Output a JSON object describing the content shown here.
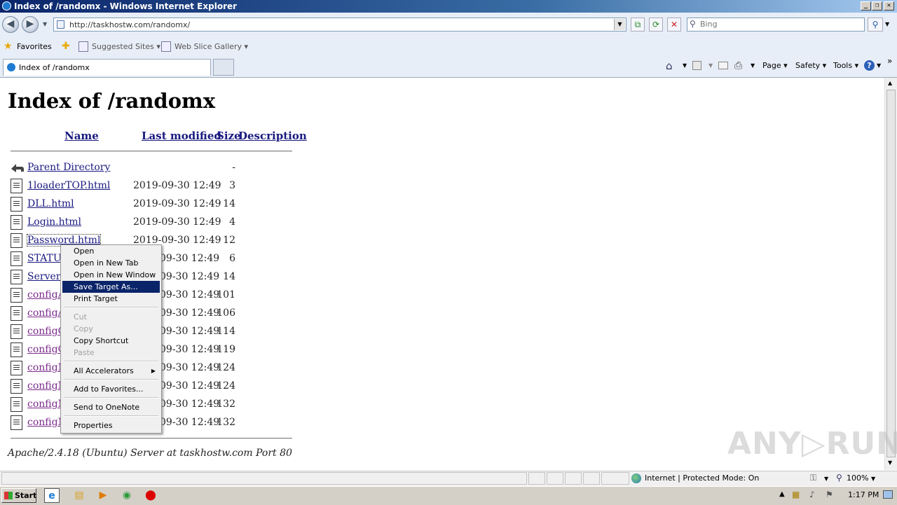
{
  "window": {
    "title": "Index of /randomx - Windows Internet Explorer",
    "minimize": "_",
    "restore": "❐",
    "close": "✕"
  },
  "address": {
    "url": "http://taskhostw.com/randomx/",
    "search_placeholder": "Bing"
  },
  "favorites": {
    "label": "Favorites",
    "suggested": "Suggested Sites ▾",
    "webslice": "Web Slice Gallery ▾"
  },
  "tab": {
    "label": "Index of /randomx"
  },
  "commandbar": {
    "page": "Page ▾",
    "safety": "Safety ▾",
    "tools": "Tools ▾",
    "more": "»"
  },
  "page": {
    "heading": "Index of /randomx",
    "columns": {
      "name": "Name",
      "modified": "Last modified",
      "size": "Size",
      "description": "Description"
    },
    "parent": {
      "name": "Parent Directory",
      "size": "-"
    },
    "rows": [
      {
        "name": "1loaderTOP.html",
        "modified": "2019-09-30 12:49",
        "size": "3"
      },
      {
        "name": "DLL.html",
        "modified": "2019-09-30 12:49",
        "size": "14"
      },
      {
        "name": "Login.html",
        "modified": "2019-09-30 12:49",
        "size": "4"
      },
      {
        "name": "Password.html",
        "modified": "2019-09-30 12:49",
        "size": "12"
      },
      {
        "name": "STATU",
        "modified": "09-30 12:49",
        "size": "6"
      },
      {
        "name": "Server.",
        "modified": "09-30 12:49",
        "size": "14"
      },
      {
        "name": "configA",
        "modified": "09-30 12:49",
        "size": "101"
      },
      {
        "name": "configA",
        "modified": "09-30 12:49",
        "size": "106"
      },
      {
        "name": "configC",
        "modified": "09-30 12:49",
        "size": "114"
      },
      {
        "name": "configC",
        "modified": "09-30 12:49",
        "size": "119"
      },
      {
        "name": "configN",
        "modified": "09-30 12:49",
        "size": "124"
      },
      {
        "name": "configN",
        "modified": "09-30 12:49",
        "size": "124"
      },
      {
        "name": "configN",
        "modified": "09-30 12:49",
        "size": "132"
      },
      {
        "name": "configN",
        "modified": "09-30 12:49",
        "size": "132"
      }
    ],
    "footer": "Apache/2.4.18 (Ubuntu) Server at taskhostw.com Port 80"
  },
  "context_menu": {
    "open": "Open",
    "open_tab": "Open in New Tab",
    "open_window": "Open in New Window",
    "save_target": "Save Target As...",
    "print_target": "Print Target",
    "cut": "Cut",
    "copy": "Copy",
    "copy_shortcut": "Copy Shortcut",
    "paste": "Paste",
    "accelerators": "All Accelerators",
    "add_favorites": "Add to Favorites...",
    "onenote": "Send to OneNote",
    "properties": "Properties"
  },
  "statusbar": {
    "zone": "Internet | Protected Mode: On",
    "zoom": "100%"
  },
  "taskbar": {
    "start": "Start",
    "clock": "1:17 PM"
  },
  "watermark": "ANY▷RUN"
}
